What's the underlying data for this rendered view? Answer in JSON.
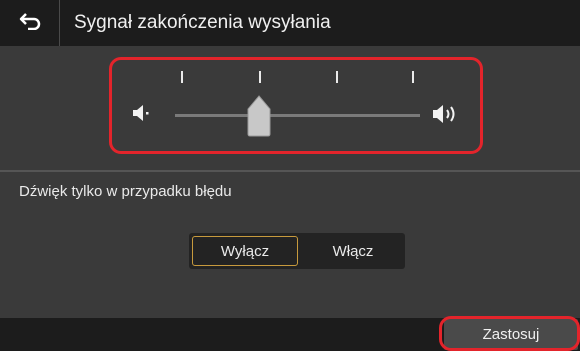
{
  "header": {
    "back_icon": "back-arrow-icon",
    "title": "Sygnał zakończenia wysyłania"
  },
  "volume": {
    "level_steps": 5,
    "current_step": 2,
    "low_icon": "speaker-low-icon",
    "high_icon": "speaker-high-icon",
    "highlight_color": "#e3242b"
  },
  "error_sound": {
    "label": "Dźwięk tylko w przypadku błędu",
    "options": [
      "Wyłącz",
      "Włącz"
    ],
    "selected": "Wyłącz",
    "selected_border_color": "#c79a3d"
  },
  "footer": {
    "apply_label": "Zastosuj"
  }
}
